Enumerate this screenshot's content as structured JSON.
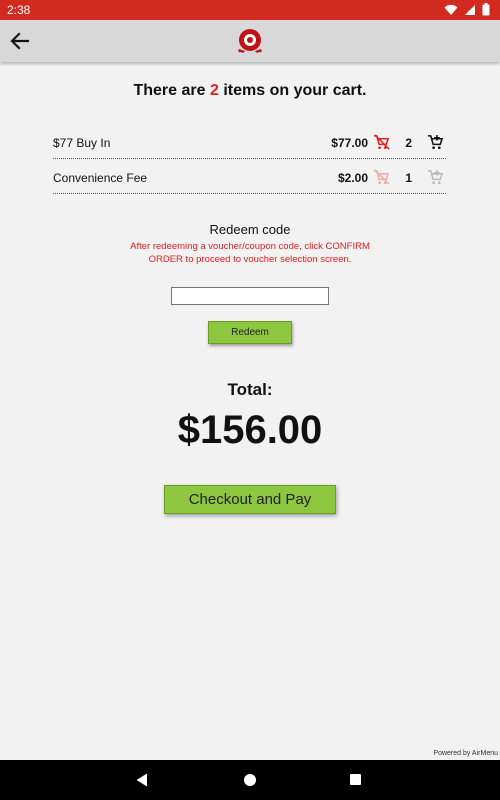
{
  "status_bar": {
    "time": "2:38",
    "background": "#d32a20"
  },
  "app_bar": {
    "back_icon": "arrow-left-icon",
    "logo_icon": "restaurant-logo-icon"
  },
  "cart": {
    "headline_prefix": "There are",
    "item_count": "2",
    "headline_suffix": "items on your cart.",
    "items": [
      {
        "name": "$77 Buy In",
        "price": "$77.00",
        "quantity": "2",
        "remove_enabled": true,
        "add_enabled": true
      },
      {
        "name": "Convenience Fee",
        "price": "$2.00",
        "quantity": "1",
        "remove_enabled": false,
        "add_enabled": false
      }
    ]
  },
  "redeem": {
    "title": "Redeem code",
    "note": "After redeeming a voucher/coupon code, click CONFIRM ORDER to proceed to voucher selection screen.",
    "input_value": "",
    "input_placeholder": "",
    "button_label": "Redeem"
  },
  "total": {
    "label": "Total:",
    "amount": "$156.00"
  },
  "checkout": {
    "button_label": "Checkout and Pay"
  },
  "footer": {
    "powered_by": "Powered by AirMenu"
  },
  "colors": {
    "accent_red": "#e02020",
    "button_green": "#8dc63f",
    "app_bar": "#d8d8d8",
    "background": "#f2f2f2"
  }
}
